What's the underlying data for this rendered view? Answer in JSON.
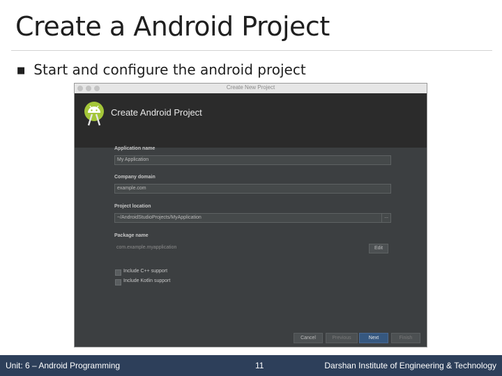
{
  "slide": {
    "title": "Create a Android Project",
    "bullet": "Start and configure the android project"
  },
  "window": {
    "title": "Create New Project",
    "heading": "Create Android Project",
    "fields": {
      "app_name_label": "Application name",
      "app_name_value": "My Application",
      "company_label": "Company domain",
      "company_value": "example.com",
      "location_label": "Project location",
      "location_value": "~/AndroidStudioProjects/MyApplication",
      "location_button": "...",
      "package_label": "Package name",
      "package_value": "com.example.myapplication",
      "edit_button": "Edit"
    },
    "checkboxes": {
      "cpp": "Include C++ support",
      "kotlin": "Include Kotlin support"
    },
    "buttons": {
      "cancel": "Cancel",
      "previous": "Previous",
      "next": "Next",
      "finish": "Finish"
    }
  },
  "footer": {
    "left": "Unit: 6 –  Android Programming",
    "page": "11",
    "right": "Darshan Institute of Engineering & Technology"
  },
  "colors": {
    "footer_bar": "#2d3f5a",
    "android_green": "#a4c639",
    "primary_button": "#365880"
  }
}
